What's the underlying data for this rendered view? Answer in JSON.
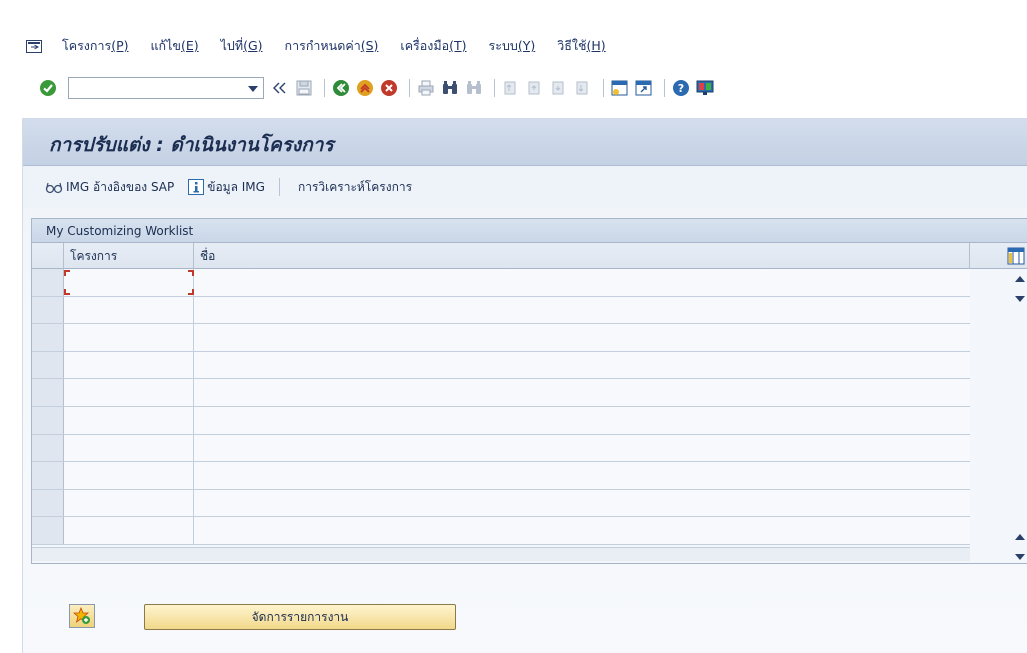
{
  "menubar": {
    "items": [
      {
        "label": "โครงการ",
        "key": "(P)"
      },
      {
        "label": "แก้ไข",
        "key": "(E)"
      },
      {
        "label": "ไปที่",
        "key": "(G)"
      },
      {
        "label": "การกำหนดค่า",
        "key": "(S)"
      },
      {
        "label": "เครื่องมือ",
        "key": "(T)"
      },
      {
        "label": "ระบบ",
        "key": "(Y)"
      },
      {
        "label": "วิธีใช้",
        "key": "(H)"
      }
    ]
  },
  "toolbar": {
    "command_field_value": "",
    "icons": [
      "enter-icon",
      "back-icon",
      "exit-icon",
      "cancel-icon",
      "print-icon",
      "find-icon",
      "find-next-icon",
      "first-page-icon",
      "previous-page-icon",
      "next-page-icon",
      "last-page-icon",
      "create-session-icon",
      "shortcut-icon",
      "help-icon",
      "customize-layout-icon"
    ],
    "colors": {
      "enter": "#3a9a3a",
      "back": "#2e8b3a",
      "exit": "#e0a020",
      "cancel": "#c0392b"
    }
  },
  "page": {
    "title": "การปรับแต่ง : ดำเนินงานโครงการ"
  },
  "app_toolbar": {
    "sap_img_label": "IMG อ้างอิงของ SAP",
    "img_info_label": "ข้อมูล IMG",
    "project_analysis_label": "การวิเคราะห์โครงการ"
  },
  "worklist": {
    "header": "My Customizing Worklist",
    "columns": [
      "โครงการ",
      "ชื่อ"
    ],
    "rows": [
      {
        "project": "",
        "name": ""
      },
      {
        "project": "",
        "name": ""
      },
      {
        "project": "",
        "name": ""
      },
      {
        "project": "",
        "name": ""
      },
      {
        "project": "",
        "name": ""
      },
      {
        "project": "",
        "name": ""
      },
      {
        "project": "",
        "name": ""
      },
      {
        "project": "",
        "name": ""
      },
      {
        "project": "",
        "name": ""
      },
      {
        "project": "",
        "name": ""
      }
    ]
  },
  "buttons": {
    "manage_worklist": "จัดการรายการงาน"
  }
}
